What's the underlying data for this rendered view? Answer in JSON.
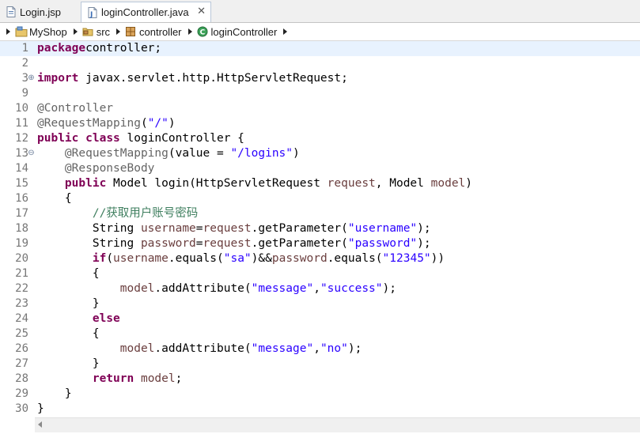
{
  "tabs": [
    {
      "label": "Login.jsp",
      "active": false
    },
    {
      "label": "loginController.java",
      "active": true
    }
  ],
  "close_icon": "✕",
  "breadcrumb": [
    {
      "label": "MyShop",
      "icon": "project-icon"
    },
    {
      "label": "src",
      "icon": "source-folder-icon"
    },
    {
      "label": "controller",
      "icon": "package-icon"
    },
    {
      "label": "loginController",
      "icon": "class-icon"
    }
  ],
  "colors": {
    "keyword": "#7f0055",
    "annotation": "#646464",
    "string": "#2a00ff",
    "variable": "#6a3e3e",
    "comment": "#3f7f5f",
    "current_line": "#e8f2fe"
  },
  "code_lines": [
    {
      "n": "1",
      "fold": "",
      "tokens": [
        [
          "kw",
          "package"
        ],
        [
          "",
          "controller;"
        ]
      ]
    },
    {
      "n": "2",
      "fold": "",
      "tokens": []
    },
    {
      "n": "3",
      "fold": "⊕",
      "tokens": [
        [
          "kw",
          "import"
        ],
        [
          "",
          " javax.servlet.http.HttpServletRequest;"
        ]
      ]
    },
    {
      "n": "9",
      "fold": "",
      "tokens": []
    },
    {
      "n": "10",
      "fold": "",
      "tokens": [
        [
          "ann",
          "@Controller"
        ]
      ]
    },
    {
      "n": "11",
      "fold": "",
      "tokens": [
        [
          "ann",
          "@RequestMapping"
        ],
        [
          "",
          "("
        ],
        [
          "str",
          "\"/\""
        ],
        [
          "",
          ")"
        ]
      ]
    },
    {
      "n": "12",
      "fold": "",
      "tokens": [
        [
          "kw",
          "public"
        ],
        [
          "",
          " "
        ],
        [
          "kw",
          "class"
        ],
        [
          "",
          " loginController {"
        ]
      ]
    },
    {
      "n": "13",
      "fold": "⊖",
      "tokens": [
        [
          "",
          "    "
        ],
        [
          "ann",
          "@RequestMapping"
        ],
        [
          "",
          "(value = "
        ],
        [
          "str",
          "\"/logins\""
        ],
        [
          "",
          ")"
        ]
      ]
    },
    {
      "n": "14",
      "fold": "",
      "tokens": [
        [
          "",
          "    "
        ],
        [
          "ann",
          "@ResponseBody"
        ]
      ]
    },
    {
      "n": "15",
      "fold": "",
      "tokens": [
        [
          "",
          "    "
        ],
        [
          "kw",
          "public"
        ],
        [
          "",
          " Model login(HttpServletRequest "
        ],
        [
          "var",
          "request"
        ],
        [
          "",
          ", Model "
        ],
        [
          "var",
          "model"
        ],
        [
          "",
          ")"
        ]
      ]
    },
    {
      "n": "16",
      "fold": "",
      "tokens": [
        [
          "",
          "    {"
        ]
      ]
    },
    {
      "n": "17",
      "fold": "",
      "tokens": [
        [
          "",
          "        "
        ],
        [
          "cmt",
          "//获取用户账号密码"
        ]
      ]
    },
    {
      "n": "18",
      "fold": "",
      "tokens": [
        [
          "",
          "        String "
        ],
        [
          "var",
          "username"
        ],
        [
          "",
          "="
        ],
        [
          "var",
          "request"
        ],
        [
          "",
          ".getParameter("
        ],
        [
          "str",
          "\"username\""
        ],
        [
          "",
          ");"
        ]
      ]
    },
    {
      "n": "19",
      "fold": "",
      "tokens": [
        [
          "",
          "        String "
        ],
        [
          "var",
          "password"
        ],
        [
          "",
          "="
        ],
        [
          "var",
          "request"
        ],
        [
          "",
          ".getParameter("
        ],
        [
          "str",
          "\"password\""
        ],
        [
          "",
          ");"
        ]
      ]
    },
    {
      "n": "20",
      "fold": "",
      "tokens": [
        [
          "",
          "        "
        ],
        [
          "kw",
          "if"
        ],
        [
          "",
          "("
        ],
        [
          "var",
          "username"
        ],
        [
          "",
          ".equals("
        ],
        [
          "str",
          "\"sa\""
        ],
        [
          "",
          ")&&"
        ],
        [
          "var",
          "password"
        ],
        [
          "",
          ".equals("
        ],
        [
          "str",
          "\"12345\""
        ],
        [
          "",
          "))"
        ]
      ]
    },
    {
      "n": "21",
      "fold": "",
      "tokens": [
        [
          "",
          "        {"
        ]
      ]
    },
    {
      "n": "22",
      "fold": "",
      "tokens": [
        [
          "",
          "            "
        ],
        [
          "var",
          "model"
        ],
        [
          "",
          ".addAttribute("
        ],
        [
          "str",
          "\"message\""
        ],
        [
          "",
          ","
        ],
        [
          "str",
          "\"success\""
        ],
        [
          "",
          ");"
        ]
      ]
    },
    {
      "n": "23",
      "fold": "",
      "tokens": [
        [
          "",
          "        }"
        ]
      ]
    },
    {
      "n": "24",
      "fold": "",
      "tokens": [
        [
          "",
          "        "
        ],
        [
          "kw",
          "else"
        ]
      ]
    },
    {
      "n": "25",
      "fold": "",
      "tokens": [
        [
          "",
          "        {"
        ]
      ]
    },
    {
      "n": "26",
      "fold": "",
      "tokens": [
        [
          "",
          "            "
        ],
        [
          "var",
          "model"
        ],
        [
          "",
          ".addAttribute("
        ],
        [
          "str",
          "\"message\""
        ],
        [
          "",
          ","
        ],
        [
          "str",
          "\"no\""
        ],
        [
          "",
          ");"
        ]
      ]
    },
    {
      "n": "27",
      "fold": "",
      "tokens": [
        [
          "",
          "        }"
        ]
      ]
    },
    {
      "n": "28",
      "fold": "",
      "tokens": [
        [
          "",
          "        "
        ],
        [
          "kw",
          "return"
        ],
        [
          "",
          " "
        ],
        [
          "var",
          "model"
        ],
        [
          "",
          ";"
        ]
      ]
    },
    {
      "n": "29",
      "fold": "",
      "tokens": [
        [
          "",
          "    }"
        ]
      ]
    },
    {
      "n": "30",
      "fold": "",
      "tokens": [
        [
          "",
          "}"
        ]
      ]
    }
  ]
}
